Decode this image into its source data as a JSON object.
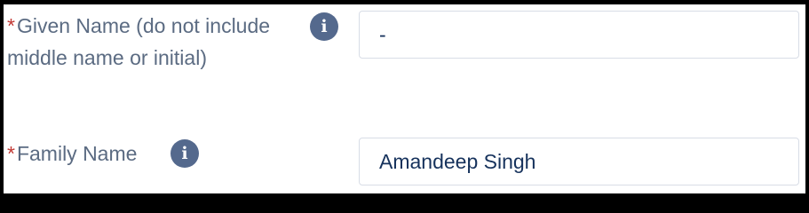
{
  "form": {
    "required_marker": "*",
    "given_name": {
      "label": "Given Name (do not include middle name or initial)",
      "info_icon": "info-icon",
      "info_glyph": "i",
      "value": "-"
    },
    "family_name": {
      "label": "Family Name",
      "info_icon": "info-icon",
      "info_glyph": "i",
      "value": "Amandeep Singh"
    }
  },
  "colors": {
    "label": "#5b6b82",
    "required": "#c23934",
    "info_icon_bg": "#54698d",
    "input_text": "#16325c",
    "input_border": "#d8dde6"
  }
}
